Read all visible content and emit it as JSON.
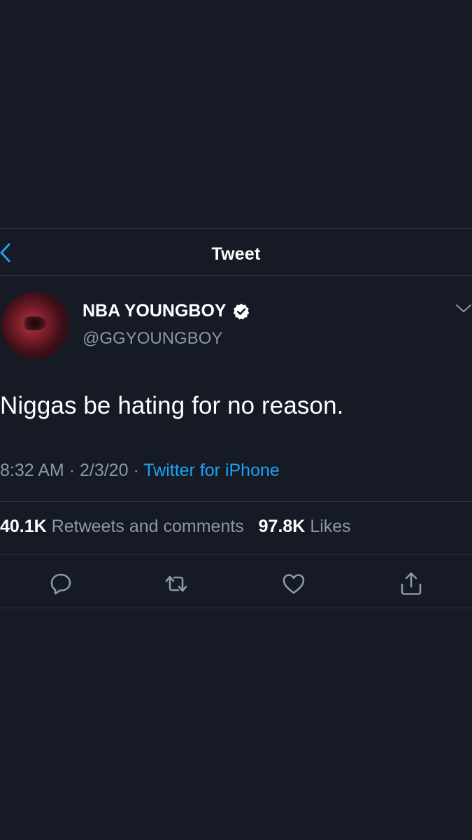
{
  "header": {
    "title": "Tweet"
  },
  "author": {
    "name": "NBA YOUNGBOY",
    "handle": "@GGYOUNGBOY"
  },
  "tweet": {
    "text": "Niggas be hating for no reason."
  },
  "meta": {
    "time": "8:32 AM",
    "separator": "·",
    "date": "2/3/20",
    "source": "Twitter for iPhone"
  },
  "stats": {
    "retweets_count": "40.1K",
    "retweets_label": "Retweets and comments",
    "likes_count": "97.8K",
    "likes_label": "Likes"
  },
  "colors": {
    "background": "#151a24",
    "accent": "#1da1f2",
    "secondary_text": "#8b98a5",
    "divider": "#2b3340"
  },
  "icons": {
    "back": "chevron-left-icon",
    "verified": "verified-badge-icon",
    "more": "chevron-down-icon",
    "reply": "reply-icon",
    "retweet": "retweet-icon",
    "like": "heart-icon",
    "share": "share-icon"
  }
}
